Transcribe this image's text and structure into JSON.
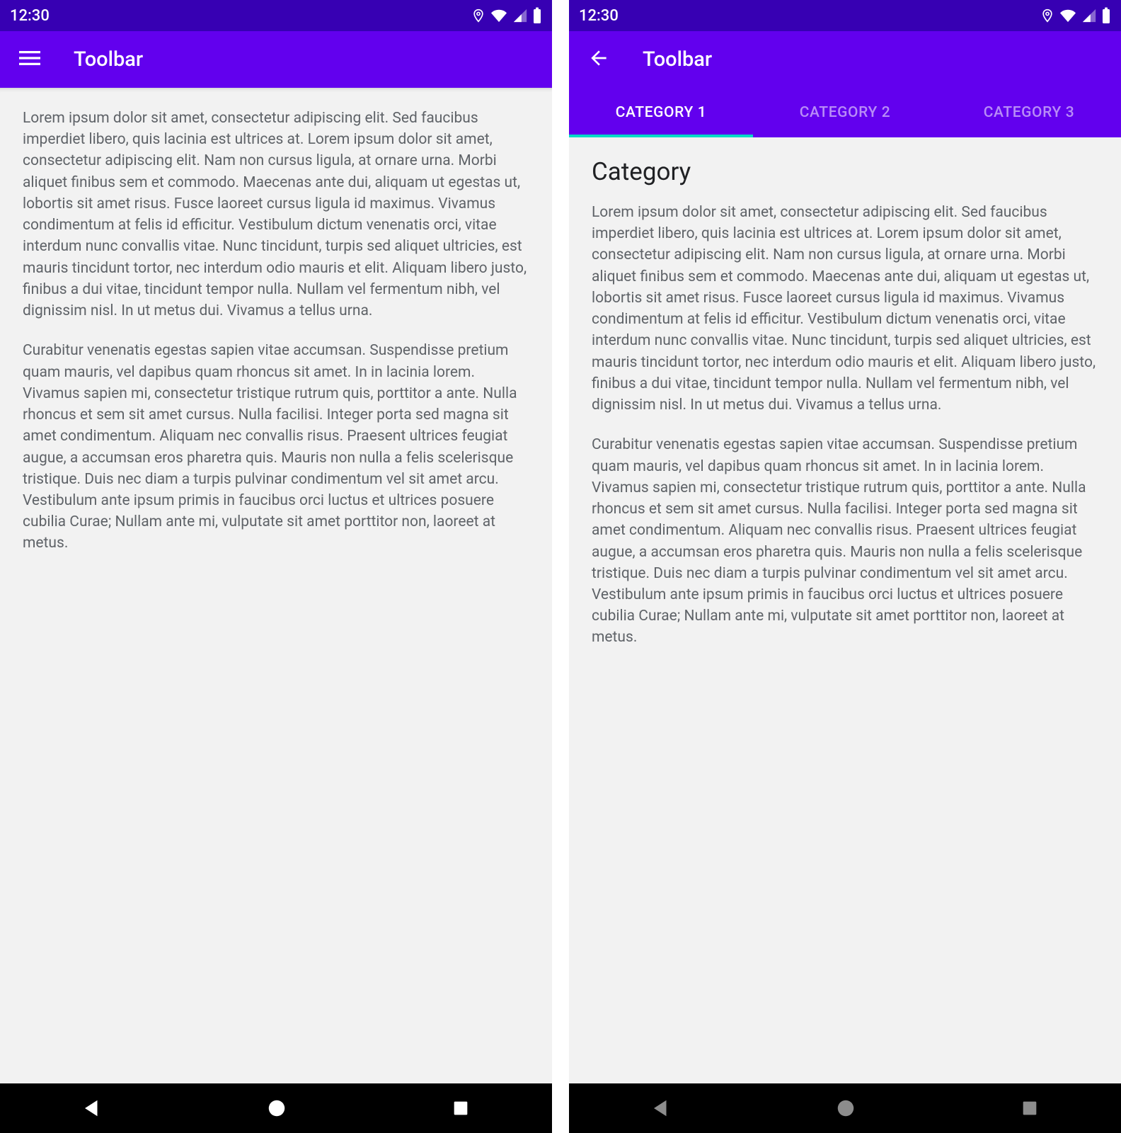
{
  "status": {
    "time": "12:30"
  },
  "colors": {
    "primary": "#6200EE",
    "primaryDark": "#3700B3",
    "accent": "#03DAC6"
  },
  "screen1": {
    "toolbar": {
      "title": "Toolbar"
    },
    "para1": "Lorem ipsum dolor sit amet, consectetur adipiscing elit. Sed faucibus imperdiet libero, quis lacinia est ultrices at. Lorem ipsum dolor sit amet, consectetur adipiscing elit. Nam non cursus ligula, at ornare urna. Morbi aliquet finibus sem et commodo. Maecenas ante dui, aliquam ut egestas ut, lobortis sit amet risus. Fusce laoreet cursus ligula id maximus. Vivamus condimentum at felis id efficitur. Vestibulum dictum venenatis orci, vitae interdum nunc convallis vitae. Nunc tincidunt, turpis sed aliquet ultricies, est mauris tincidunt tortor, nec interdum odio mauris et elit. Aliquam libero justo, finibus a dui vitae, tincidunt tempor nulla. Nullam vel fermentum nibh, vel dignissim nisl. In ut metus dui. Vivamus a tellus urna.",
    "para2": "Curabitur venenatis egestas sapien vitae accumsan. Suspendisse pretium quam mauris, vel dapibus quam rhoncus sit amet. In in lacinia lorem. Vivamus sapien mi, consectetur tristique rutrum quis, porttitor a ante. Nulla rhoncus et sem sit amet cursus. Nulla facilisi. Integer porta sed magna sit amet condimentum. Aliquam nec convallis risus. Praesent ultrices feugiat augue, a accumsan eros pharetra quis. Mauris non nulla a felis scelerisque tristique. Duis nec diam a turpis pulvinar condimentum vel sit amet arcu. Vestibulum ante ipsum primis in faucibus orci luctus et ultrices posuere cubilia Curae; Nullam ante mi, vulputate sit amet porttitor non, laoreet at metus."
  },
  "screen2": {
    "toolbar": {
      "title": "Toolbar"
    },
    "tabs": [
      "CATEGORY 1",
      "CATEGORY 2",
      "CATEGORY 3"
    ],
    "activeTab": 0,
    "heading": "Category",
    "para1": "Lorem ipsum dolor sit amet, consectetur adipiscing elit. Sed faucibus imperdiet libero, quis lacinia est ultrices at. Lorem ipsum dolor sit amet, consectetur adipiscing elit. Nam non cursus ligula, at ornare urna. Morbi aliquet finibus sem et commodo. Maecenas ante dui, aliquam ut egestas ut, lobortis sit amet risus. Fusce laoreet cursus ligula id maximus. Vivamus condimentum at felis id efficitur. Vestibulum dictum venenatis orci, vitae interdum nunc convallis vitae. Nunc tincidunt, turpis sed aliquet ultricies, est mauris tincidunt tortor, nec interdum odio mauris et elit. Aliquam libero justo, finibus a dui vitae, tincidunt tempor nulla. Nullam vel fermentum nibh, vel dignissim nisl. In ut metus dui. Vivamus a tellus urna.",
    "para2": "Curabitur venenatis egestas sapien vitae accumsan. Suspendisse pretium quam mauris, vel dapibus quam rhoncus sit amet. In in lacinia lorem. Vivamus sapien mi, consectetur tristique rutrum quis, porttitor a ante. Nulla rhoncus et sem sit amet cursus. Nulla facilisi. Integer porta sed magna sit amet condimentum. Aliquam nec convallis risus. Praesent ultrices feugiat augue, a accumsan eros pharetra quis. Mauris non nulla a felis scelerisque tristique. Duis nec diam a turpis pulvinar condimentum vel sit amet arcu. Vestibulum ante ipsum primis in faucibus orci luctus et ultrices posuere cubilia Curae; Nullam ante mi, vulputate sit amet porttitor non, laoreet at metus."
  }
}
